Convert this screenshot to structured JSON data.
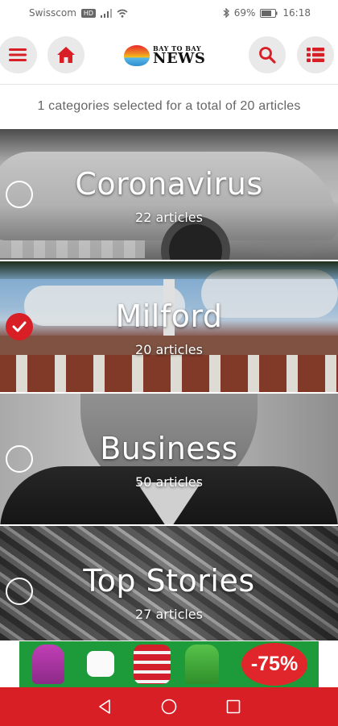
{
  "status_bar": {
    "carrier": "Swisscom",
    "network_badge": "HD",
    "battery": "69%",
    "time": "16:18"
  },
  "header": {
    "logo_small": "BAY TO BAY",
    "logo_big": "NEWS",
    "icons": [
      "menu-icon",
      "home-icon",
      "search-icon",
      "list-icon"
    ],
    "accent_color": "#d81f26"
  },
  "summary": "1 categories selected for a total of 20 articles",
  "categories": [
    {
      "name": "Coronavirus",
      "count": "22 articles",
      "selected": false
    },
    {
      "name": "Milford",
      "count": "20 articles",
      "selected": true
    },
    {
      "name": "Business",
      "count": "50 articles",
      "selected": false
    },
    {
      "name": "Top Stories",
      "count": "27 articles",
      "selected": false
    }
  ],
  "ad": {
    "discount": "-75%"
  },
  "navbar": {
    "icons": [
      "back-icon",
      "home-circle-icon",
      "recents-icon"
    ]
  }
}
